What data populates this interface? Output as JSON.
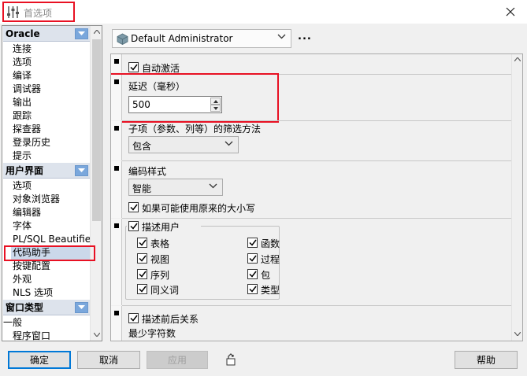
{
  "window": {
    "title": "首选项"
  },
  "categories": [
    {
      "header": "Oracle",
      "items": [
        "连接",
        "选项",
        "编译",
        "调试器",
        "输出",
        "跟踪",
        "探查器",
        "登录历史",
        "提示"
      ]
    },
    {
      "header": "用户界面",
      "items": [
        "选项",
        "对象浏览器",
        "编辑器",
        "字体",
        "PL/SQL Beautifier",
        "代码助手",
        "按键配置",
        "外观",
        "NLS 选项"
      ]
    },
    {
      "header": "窗口类型",
      "items": [
        "一般",
        "程序窗口"
      ]
    }
  ],
  "selected_item": "代码助手",
  "profile": {
    "name": "Default Administrator",
    "more": "..."
  },
  "settings": {
    "auto_activate": {
      "label": "自动激活",
      "checked": true
    },
    "delay": {
      "label": "延迟（毫秒）",
      "value": "500"
    },
    "filter": {
      "label": "子项（参数、列等）的筛选方法",
      "value": "包含"
    },
    "coding_style": {
      "label": "编码样式",
      "value": "智能"
    },
    "use_original_case": {
      "label": "如果可能使用原来的大小写",
      "checked": true
    },
    "describe_users": {
      "label": "描述用户",
      "checked": true,
      "items_left": [
        "表格",
        "视图",
        "序列",
        "同义词"
      ],
      "items_right": [
        "函数",
        "过程",
        "包",
        "类型"
      ]
    },
    "describe_context": {
      "label": "描述前后关系",
      "checked": true
    },
    "min_chars": {
      "label": "最少字符数"
    }
  },
  "buttons": {
    "ok": "确定",
    "cancel": "取消",
    "apply": "应用",
    "help": "帮助"
  },
  "colors": {
    "highlight": "#e81123",
    "selection": "#cbd8ea",
    "dropdown_accent": "#7aa7dc"
  }
}
